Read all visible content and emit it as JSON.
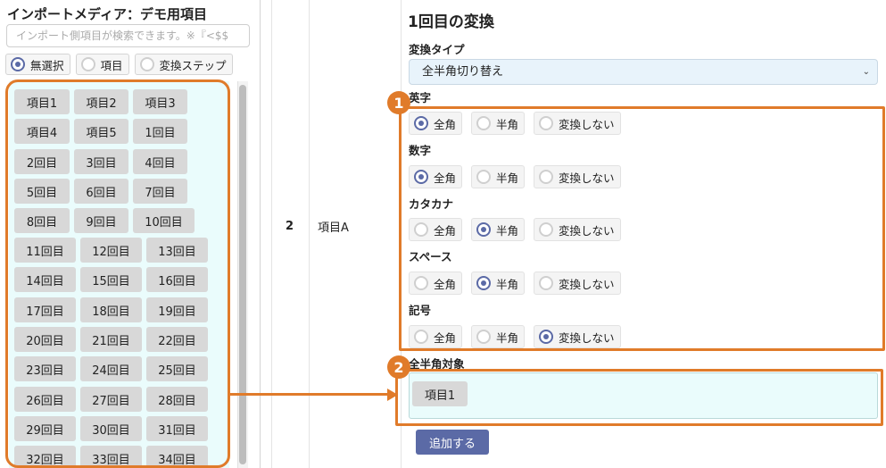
{
  "left_panel": {
    "title": "インポートメディア：デモ用項目",
    "search_placeholder": "インポート側項目が検索できます。※『<$$",
    "modes": [
      {
        "label": "無選択",
        "selected": true
      },
      {
        "label": "項目",
        "selected": false
      },
      {
        "label": "変換ステップ",
        "selected": false
      }
    ],
    "items": [
      "項目1",
      "項目2",
      "項目3",
      "項目4",
      "項目5",
      "1回目",
      "2回目",
      "3回目",
      "4回目",
      "5回目",
      "6回目",
      "7回目",
      "8回目",
      "9回目",
      "10回目",
      "11回目",
      "12回目",
      "13回目",
      "14回目",
      "15回目",
      "16回目",
      "17回目",
      "18回目",
      "19回目",
      "20回目",
      "21回目",
      "22回目",
      "23回目",
      "24回目",
      "25回目",
      "26回目",
      "27回目",
      "28回目",
      "29回目",
      "30回目",
      "31回目",
      "32回目",
      "33回目",
      "34回目"
    ]
  },
  "row": {
    "number": "2",
    "name": "項目A"
  },
  "right_panel": {
    "title": "1回目の変換",
    "conversion_type_label": "変換タイプ",
    "conversion_type_value": "全半角切り替え",
    "groups": [
      {
        "label": "英字",
        "options": [
          "全角",
          "半角",
          "変換しない"
        ],
        "selected": 0
      },
      {
        "label": "数字",
        "options": [
          "全角",
          "半角",
          "変換しない"
        ],
        "selected": 0
      },
      {
        "label": "カタカナ",
        "options": [
          "全角",
          "半角",
          "変換しない"
        ],
        "selected": 1
      },
      {
        "label": "スペース",
        "options": [
          "全角",
          "半角",
          "変換しない"
        ],
        "selected": 1
      },
      {
        "label": "記号",
        "options": [
          "全角",
          "半角",
          "変換しない"
        ],
        "selected": 2
      }
    ],
    "target_label": "全半角対象",
    "target_items": [
      "項目1"
    ],
    "add_button": "追加する"
  },
  "annotations": {
    "badge1": "1",
    "badge2": "2",
    "color": "#e07b2a"
  },
  "colors": {
    "accent": "#5b6aa6",
    "list_bg": "#eafcfc",
    "select_bg": "#e8f3fb"
  }
}
